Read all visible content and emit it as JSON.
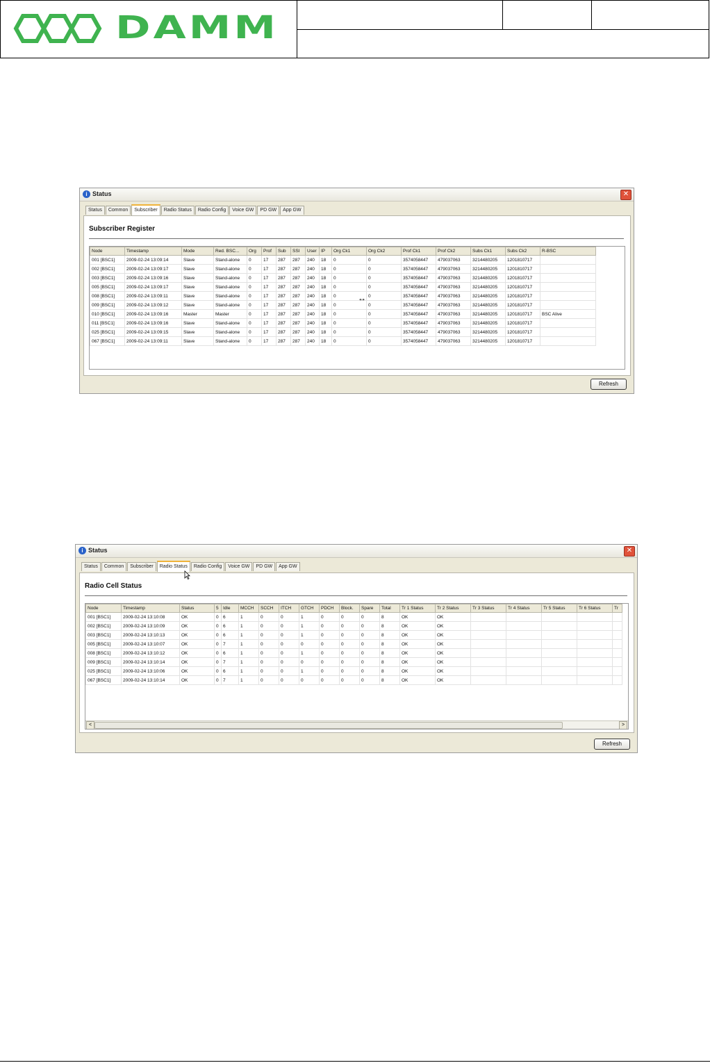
{
  "header": {
    "logo_text": "DAMM"
  },
  "window1": {
    "title": "Status",
    "tabs": [
      "Status",
      "Common",
      "Subscriber",
      "Radio Status",
      "Radio Config",
      "Voice GW",
      "PD GW",
      "App GW"
    ],
    "active_tab": 2,
    "panel_title": "Subscriber Register",
    "columns": [
      "Node",
      "Timestamp",
      "Mode",
      "Red. BSC...",
      "Org",
      "Prof",
      "Sub",
      "SSI",
      "User",
      "IP",
      "Org Ck1",
      "Org Ck2",
      "Prof Ck1",
      "Prof Ck2",
      "Subs Ck1",
      "Subs Ck2",
      "R-BSC"
    ],
    "rows": [
      [
        "001 [BSC1]",
        "2009-02-24 13:09:14",
        "Slave",
        "Stand-alone",
        "0",
        "17",
        "287",
        "287",
        "240",
        "18",
        "0",
        "0",
        "3574058447",
        "479037063",
        "3214480205",
        "1201810717",
        ""
      ],
      [
        "002 [BSC1]",
        "2009-02-24 13:09:17",
        "Slave",
        "Stand-alone",
        "0",
        "17",
        "287",
        "287",
        "240",
        "18",
        "0",
        "0",
        "3574058447",
        "479037063",
        "3214480205",
        "1201810717",
        ""
      ],
      [
        "003 [BSC1]",
        "2009-02-24 13:09:16",
        "Slave",
        "Stand-alone",
        "0",
        "17",
        "287",
        "287",
        "240",
        "18",
        "0",
        "0",
        "3574058447",
        "479037063",
        "3214480205",
        "1201810717",
        ""
      ],
      [
        "005 [BSC1]",
        "2009-02-24 13:09:17",
        "Slave",
        "Stand-alone",
        "0",
        "17",
        "287",
        "287",
        "240",
        "18",
        "0",
        "0",
        "3574058447",
        "479037063",
        "3214480205",
        "1201810717",
        ""
      ],
      [
        "008 [BSC1]",
        "2009-02-24 13:09:11",
        "Slave",
        "Stand-alone",
        "0",
        "17",
        "287",
        "287",
        "240",
        "18",
        "0",
        "0",
        "3574058447",
        "479037063",
        "3214480205",
        "1201810717",
        ""
      ],
      [
        "009 [BSC1]",
        "2009-02-24 13:09:12",
        "Slave",
        "Stand-alone",
        "0",
        "17",
        "287",
        "287",
        "240",
        "18",
        "0",
        "0",
        "3574058447",
        "479037063",
        "3214480205",
        "1201810717",
        ""
      ],
      [
        "010 [BSC1]",
        "2009-02-24 13:09:16",
        "Master",
        "Master",
        "0",
        "17",
        "287",
        "287",
        "240",
        "18",
        "0",
        "0",
        "3574058447",
        "479037063",
        "3214480205",
        "1201810717",
        "BSC Alive"
      ],
      [
        "011 [BSC1]",
        "2009-02-24 13:09:16",
        "Slave",
        "Stand-alone",
        "0",
        "17",
        "287",
        "287",
        "240",
        "18",
        "0",
        "0",
        "3574058447",
        "479037063",
        "3214480205",
        "1201810717",
        ""
      ],
      [
        "025 [BSC1]",
        "2009-02-24 13:09:15",
        "Slave",
        "Stand-alone",
        "0",
        "17",
        "287",
        "287",
        "240",
        "18",
        "0",
        "0",
        "3574058447",
        "479037063",
        "3214480205",
        "1201810717",
        ""
      ],
      [
        "067 [BSC1]",
        "2009-02-24 13:09:11",
        "Slave",
        "Stand-alone",
        "0",
        "17",
        "287",
        "287",
        "240",
        "18",
        "0",
        "0",
        "3574058447",
        "479037063",
        "3214480205",
        "1201810717",
        ""
      ]
    ],
    "refresh_label": "Refresh",
    "resize_cursor": "↔"
  },
  "window2": {
    "title": "Status",
    "tabs": [
      "Status",
      "Common",
      "Subscriber",
      "Radio Status",
      "Radio Config",
      "Voice GW",
      "PD GW",
      "App GW"
    ],
    "active_tab": 3,
    "panel_title": "Radio Cell Status",
    "columns": [
      "Node",
      "Timestamp",
      "Status",
      "5",
      "Idle",
      "MCCH",
      "SCCH",
      "ITCH",
      "GTCH",
      "PDCH",
      "Block.",
      "Spare",
      "Total",
      "Tr 1 Status",
      "Tr 2 Status",
      "Tr 3 Status",
      "Tr 4 Status",
      "Tr 5 Status",
      "Tr 6 Status",
      "Tr"
    ],
    "rows": [
      [
        "001 [BSC1]",
        "2009-02-24 13:10:08",
        "OK",
        "0",
        "6",
        "1",
        "0",
        "0",
        "1",
        "0",
        "0",
        "0",
        "8",
        "OK",
        "OK",
        "",
        "",
        "",
        "",
        ""
      ],
      [
        "002 [BSC1]",
        "2009-02-24 13:10:09",
        "OK",
        "0",
        "6",
        "1",
        "0",
        "0",
        "1",
        "0",
        "0",
        "0",
        "8",
        "OK",
        "OK",
        "",
        "",
        "",
        "",
        ""
      ],
      [
        "003 [BSC1]",
        "2009-02-24 13:10:13",
        "OK",
        "0",
        "6",
        "1",
        "0",
        "0",
        "1",
        "0",
        "0",
        "0",
        "8",
        "OK",
        "OK",
        "",
        "",
        "",
        "",
        ""
      ],
      [
        "005 [BSC1]",
        "2009-02-24 13:10:07",
        "OK",
        "0",
        "7",
        "1",
        "0",
        "0",
        "0",
        "0",
        "0",
        "0",
        "8",
        "OK",
        "OK",
        "",
        "",
        "",
        "",
        ""
      ],
      [
        "008 [BSC1]",
        "2009-02-24 13:10:12",
        "OK",
        "0",
        "6",
        "1",
        "0",
        "0",
        "1",
        "0",
        "0",
        "0",
        "8",
        "OK",
        "OK",
        "",
        "",
        "",
        "",
        ""
      ],
      [
        "009 [BSC1]",
        "2009-02-24 13:10:14",
        "OK",
        "0",
        "7",
        "1",
        "0",
        "0",
        "0",
        "0",
        "0",
        "0",
        "8",
        "OK",
        "OK",
        "",
        "",
        "",
        "",
        ""
      ],
      [
        "025 [BSC1]",
        "2009-02-24 13:10:06",
        "OK",
        "0",
        "6",
        "1",
        "0",
        "0",
        "1",
        "0",
        "0",
        "0",
        "8",
        "OK",
        "OK",
        "",
        "",
        "",
        "",
        ""
      ],
      [
        "067 [BSC1]",
        "2009-02-24 13:10:14",
        "OK",
        "0",
        "7",
        "1",
        "0",
        "0",
        "0",
        "0",
        "0",
        "0",
        "8",
        "OK",
        "OK",
        "",
        "",
        "",
        "",
        ""
      ]
    ],
    "refresh_label": "Refresh",
    "scroll_left": "<",
    "scroll_right": ">"
  },
  "colors": {
    "logo_green": "#3fb34f",
    "tab_highlight": "#f0b33a",
    "close_red": "#e0523a"
  }
}
